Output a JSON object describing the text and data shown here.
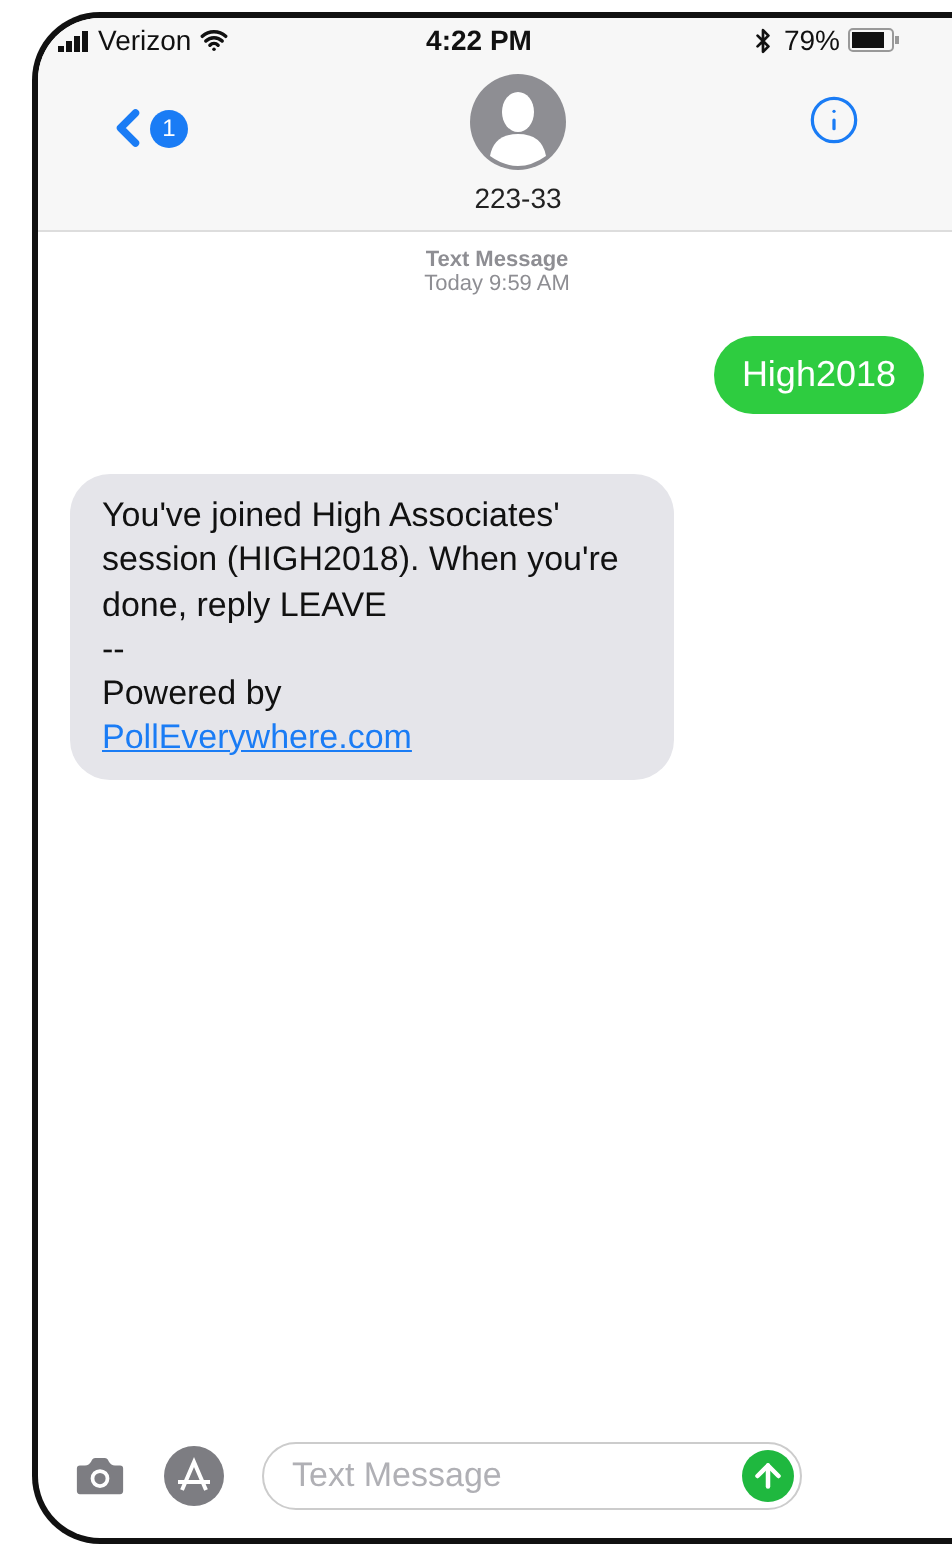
{
  "status_bar": {
    "carrier": "Verizon",
    "time": "4:22 PM",
    "battery": "79%"
  },
  "header": {
    "back_badge": "1",
    "contact": "223-33"
  },
  "timestamp": {
    "label": "Text Message",
    "time": "Today 9:59 AM"
  },
  "messages": [
    {
      "kind": "sent",
      "parts": [
        {
          "kind": "text",
          "text": "High2018"
        }
      ]
    },
    {
      "kind": "received",
      "parts": [
        {
          "kind": "text",
          "text": "You've joined High Associates' session (HIGH2018). When you're done, reply LEAVE\n--\nPowered by"
        },
        {
          "kind": "link",
          "text": "PollEverywhere.com"
        }
      ]
    }
  ],
  "composer": {
    "placeholder": "Text Message"
  }
}
